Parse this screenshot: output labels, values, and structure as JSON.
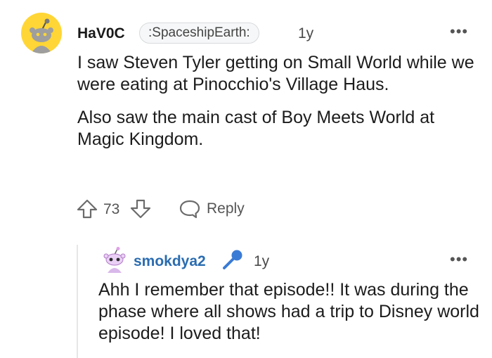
{
  "comment": {
    "username": "HaV0C",
    "flair": ":SpaceshipEarth:",
    "age": "1y",
    "paragraphs": [
      "I saw Steven Tyler getting on Small World while we were eating at Pinocchio's Village Haus.",
      "Also saw the main cast of Boy Meets World at Magic Kingdom."
    ],
    "score": "73",
    "reply_label": "Reply",
    "avatar_icon": "snoo-avatar-icon",
    "menu_icon": "more-options-icon",
    "colors": {
      "avatar_bg": "#ffd635"
    }
  },
  "reply": {
    "username": "smokdya2",
    "age": "1y",
    "text": "Ahh I remember that episode!! It was during the phase where all shows had a trip to Disney world episode! I loved that!",
    "username_color": "#2b6cb0",
    "flair_icon": "microphone-icon",
    "avatar_icon": "snoo-avatar-icon",
    "menu_icon": "more-options-icon"
  }
}
